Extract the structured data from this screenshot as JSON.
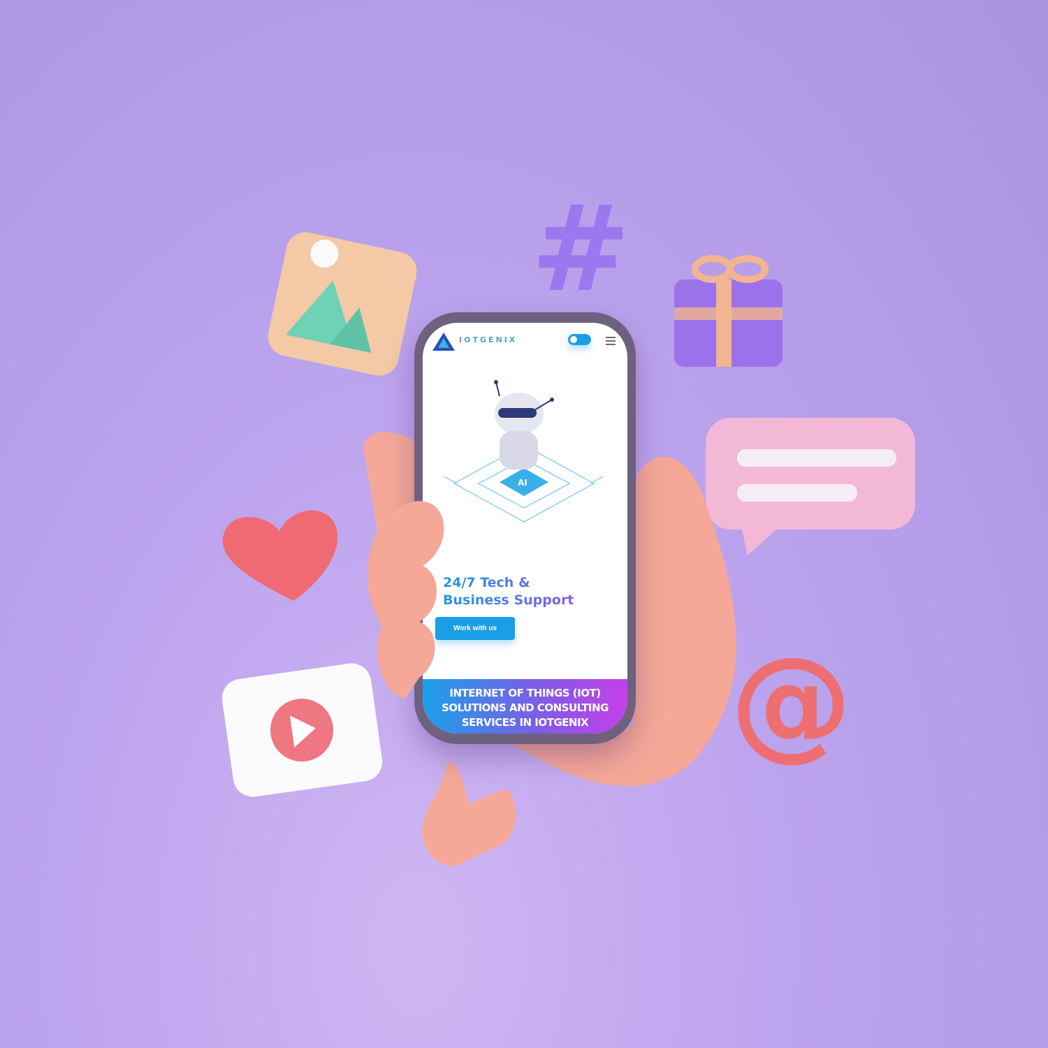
{
  "brand": {
    "name": "IOTGENIX",
    "accent": "#1a9fe6"
  },
  "header": {
    "menu_icon": "hamburger-icon",
    "toggle_icon": "toggle-switch"
  },
  "hero": {
    "chip_label": "AI",
    "headline_line1": "24/7 Tech &",
    "headline_line2": "Business Support",
    "cta_label": "Work with us"
  },
  "banner": {
    "line1": "INTERNET OF THINGS (IOT)",
    "line2": "SOLUTIONS AND CONSULTING",
    "line3": "SERVICES IN IOTGENIX"
  },
  "decor": {
    "hash_symbol": "#",
    "at_symbol": "@"
  }
}
